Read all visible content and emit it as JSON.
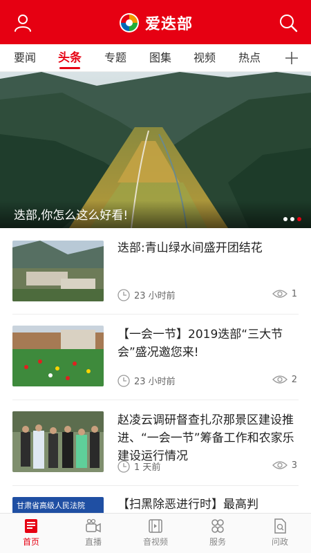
{
  "header": {
    "brand": "爱迭部",
    "user_icon": "user-icon",
    "search_icon": "search-icon",
    "accent_color": "#e60012"
  },
  "tabs": [
    {
      "label": "要闻",
      "active": false
    },
    {
      "label": "头条",
      "active": true
    },
    {
      "label": "专题",
      "active": false
    },
    {
      "label": "图集",
      "active": false
    },
    {
      "label": "视频",
      "active": false
    },
    {
      "label": "热点",
      "active": false
    }
  ],
  "tab_add_icon": "plus-icon",
  "banner": {
    "caption": "迭部,你怎么这么好看!",
    "slides": 3,
    "active_slide": 3
  },
  "news": [
    {
      "title": "迭部:青山绿水间盛开团结花",
      "time": "23 小时前",
      "views": "1"
    },
    {
      "title": "【一会一节】2019迭部“三大节会”盛况邀您来!",
      "time": "23 小时前",
      "views": "2"
    },
    {
      "title": "赵凌云调研督查扎尕那景区建设推进、“一会一节”筹备工作和农家乐建设运行情况",
      "time": "1 天前",
      "views": "3"
    },
    {
      "title": "【扫黑除恶进行时】最高判",
      "thumb_text": "甘肃省高级人民法院"
    }
  ],
  "bottom_nav": [
    {
      "label": "首页",
      "icon": "home-news-icon",
      "active": true
    },
    {
      "label": "直播",
      "icon": "live-camera-icon",
      "active": false
    },
    {
      "label": "音视频",
      "icon": "film-icon",
      "active": false
    },
    {
      "label": "服务",
      "icon": "service-icon",
      "active": false
    },
    {
      "label": "问政",
      "icon": "inquiry-icon",
      "active": false
    }
  ]
}
